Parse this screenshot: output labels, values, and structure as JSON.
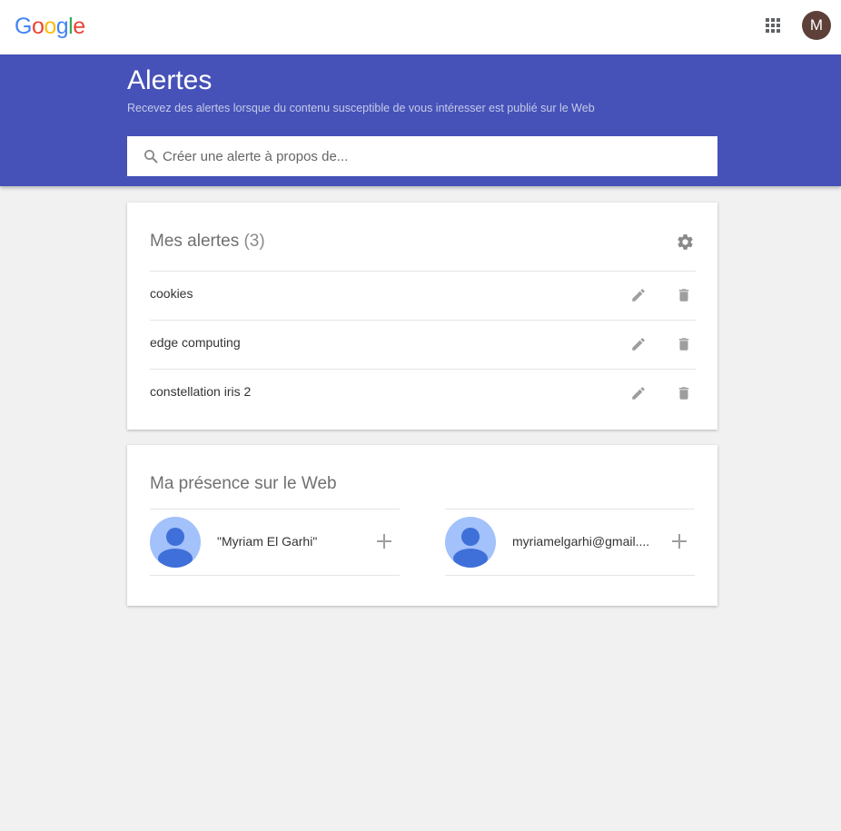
{
  "header": {
    "logo_letters": [
      {
        "char": "G",
        "color": "#4285F4"
      },
      {
        "char": "o",
        "color": "#EA4335"
      },
      {
        "char": "o",
        "color": "#FBBC05"
      },
      {
        "char": "g",
        "color": "#4285F4"
      },
      {
        "char": "l",
        "color": "#34A853"
      },
      {
        "char": "e",
        "color": "#EA4335"
      }
    ],
    "apps_icon": "apps-grid-icon",
    "avatar_initial": "M",
    "avatar_color": "#5d4037"
  },
  "hero": {
    "title": "Alertes",
    "subtitle": "Recevez des alertes lorsque du contenu susceptible de vous intéresser est publié sur le Web",
    "background": "#4652b8",
    "search_placeholder": "Créer une alerte à propos de..."
  },
  "alerts_card": {
    "title": "Mes alertes",
    "count": "(3)",
    "settings_icon": "gear-icon",
    "alerts": [
      {
        "label": "cookies"
      },
      {
        "label": "edge computing"
      },
      {
        "label": "constellation iris 2"
      }
    ]
  },
  "web_card": {
    "title": "Ma présence sur le Web",
    "profiles": [
      {
        "label": "\"Myriam El Garhi\""
      },
      {
        "label": "myriamelgarhi@gmail...."
      }
    ]
  }
}
